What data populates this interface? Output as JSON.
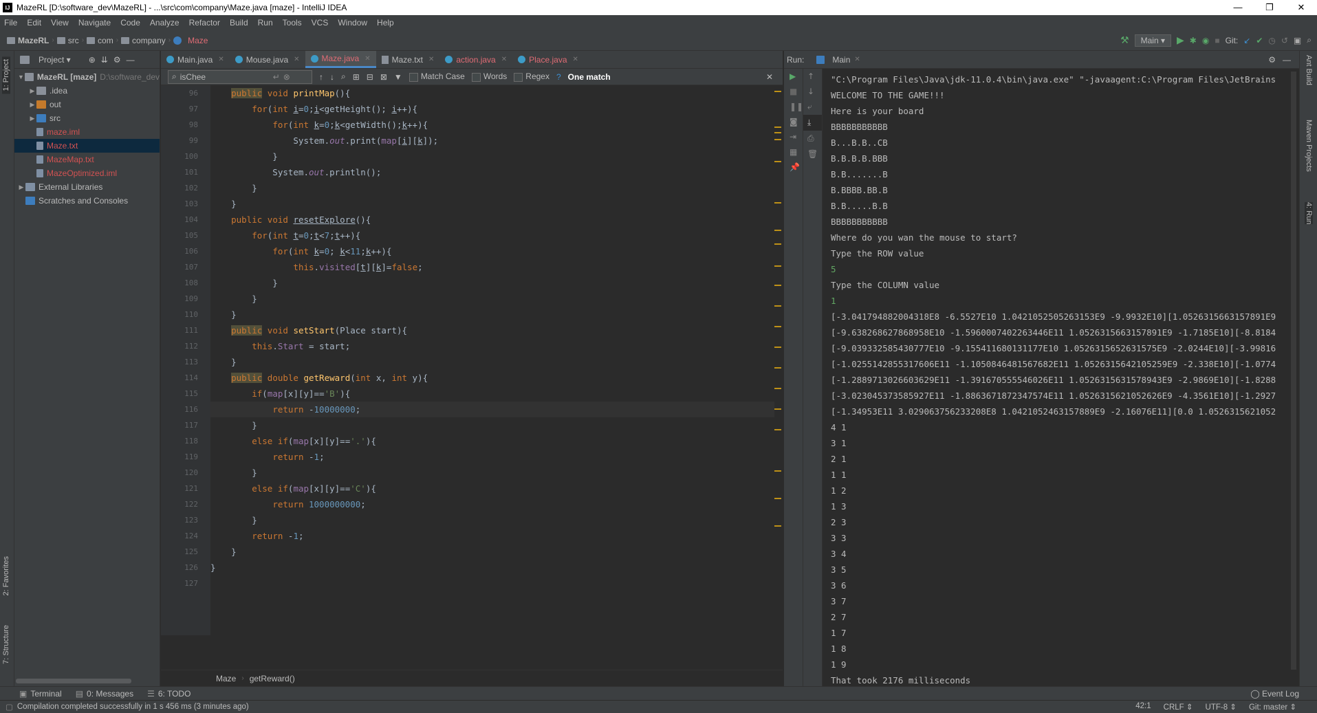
{
  "window": {
    "title": "MazeRL [D:\\software_dev\\MazeRL] - ...\\src\\com\\company\\Maze.java [maze] - IntelliJ IDEA",
    "min": "—",
    "max": "❐",
    "close": "✕"
  },
  "menu": [
    "File",
    "Edit",
    "View",
    "Navigate",
    "Code",
    "Analyze",
    "Refactor",
    "Build",
    "Run",
    "Tools",
    "VCS",
    "Window",
    "Help"
  ],
  "breadcrumb": [
    "MazeRL",
    "src",
    "com",
    "company",
    "Maze"
  ],
  "toolbar": {
    "run_config": "Main ▾",
    "git_label": "Git:"
  },
  "left_tabs": {
    "project": "1: Project",
    "favorites": "2: Favorites",
    "structure": "7: Structure"
  },
  "project_panel": {
    "title": "Project ▾",
    "tree": [
      {
        "label": "MazeRL [maze]",
        "suffix": "D:\\software_dev",
        "indent": 0,
        "arrow": "▼",
        "icon": "proj",
        "cls": ""
      },
      {
        "label": ".idea",
        "indent": 1,
        "arrow": "▶",
        "icon": "folder",
        "cls": ""
      },
      {
        "label": "out",
        "indent": 1,
        "arrow": "▶",
        "icon": "orange",
        "cls": ""
      },
      {
        "label": "src",
        "indent": 1,
        "arrow": "▶",
        "icon": "blue",
        "cls": ""
      },
      {
        "label": "maze.iml",
        "indent": 1,
        "arrow": "",
        "icon": "file",
        "cls": "red"
      },
      {
        "label": "Maze.txt",
        "indent": 1,
        "arrow": "",
        "icon": "file",
        "cls": "red",
        "selected": true
      },
      {
        "label": "MazeMap.txt",
        "indent": 1,
        "arrow": "",
        "icon": "file",
        "cls": "red"
      },
      {
        "label": "MazeOptimized.iml",
        "indent": 1,
        "arrow": "",
        "icon": "file",
        "cls": "red"
      },
      {
        "label": "External Libraries",
        "indent": 0,
        "arrow": "▶",
        "icon": "lib",
        "cls": ""
      },
      {
        "label": "Scratches and Consoles",
        "indent": 0,
        "arrow": "",
        "icon": "blue",
        "cls": ""
      }
    ]
  },
  "editor_tabs": [
    {
      "label": "Main.java",
      "icon": "c",
      "active": false
    },
    {
      "label": "Mouse.java",
      "icon": "c",
      "active": false
    },
    {
      "label": "Maze.java",
      "icon": "c",
      "active": true
    },
    {
      "label": "Maze.txt",
      "icon": "t",
      "active": false
    },
    {
      "label": "action.java",
      "icon": "c",
      "active": false
    },
    {
      "label": "Place.java",
      "icon": "c",
      "active": false
    }
  ],
  "find": {
    "value": "isChee",
    "match_case": "Match Case",
    "words": "Words",
    "regex": "Regex",
    "help": "?",
    "result": "One match"
  },
  "code_lines": [
    {
      "n": "96",
      "html": "    <span class=\"kwh\">public</span> <span class=\"kw\">void</span> <span class=\"fn\">printMap</span>(){"
    },
    {
      "n": "97",
      "html": "        <span class=\"kw\">for</span>(<span class=\"kw\">int</span> <span class=\"ul\">i</span>=<span class=\"num\">0</span>;<span class=\"ul\">i</span>&lt;getHeight(); <span class=\"ul\">i</span>++){"
    },
    {
      "n": "98",
      "html": "            <span class=\"kw\">for</span>(<span class=\"kw\">int</span> <span class=\"ul\">k</span>=<span class=\"num\">0</span>;<span class=\"ul\">k</span>&lt;getWidth();<span class=\"ul\">k</span>++){"
    },
    {
      "n": "99",
      "html": "                System.<span class=\"it\">out</span>.print(<span class=\"fld\">map</span>[<span class=\"ul\">i</span>][<span class=\"ul\">k</span>]);"
    },
    {
      "n": "100",
      "html": "            }"
    },
    {
      "n": "101",
      "html": "            System.<span class=\"it\">out</span>.println();"
    },
    {
      "n": "102",
      "html": "        }"
    },
    {
      "n": "103",
      "html": "    }"
    },
    {
      "n": "104",
      "html": "    <span class=\"kw\">public</span> <span class=\"kw\">void</span> <span class=\"ul\">resetExplore</span>(){"
    },
    {
      "n": "105",
      "html": "        <span class=\"kw\">for</span>(<span class=\"kw\">int</span> <span class=\"ul\">t</span>=<span class=\"num\">0</span>;<span class=\"ul\">t</span>&lt;<span class=\"num\">7</span>;<span class=\"ul\">t</span>++){"
    },
    {
      "n": "106",
      "html": "            <span class=\"kw\">for</span>(<span class=\"kw\">int</span> <span class=\"ul\">k</span>=<span class=\"num\">0</span>; <span class=\"ul\">k</span>&lt;<span class=\"num\">11</span>;<span class=\"ul\">k</span>++){"
    },
    {
      "n": "107",
      "html": "                <span class=\"kw\">this</span>.<span class=\"fld\">visited</span>[<span class=\"ul\">t</span>][<span class=\"ul\">k</span>]=<span class=\"kw\">false</span>;"
    },
    {
      "n": "108",
      "html": "            }"
    },
    {
      "n": "109",
      "html": "        }"
    },
    {
      "n": "110",
      "html": "    }"
    },
    {
      "n": "111",
      "html": "    <span class=\"kwh\">public</span> <span class=\"kw\">void</span> <span class=\"fn\">setStart</span>(Place start){"
    },
    {
      "n": "112",
      "html": "        <span class=\"kw\">this</span>.<span class=\"fld\">Start</span> = start;"
    },
    {
      "n": "113",
      "html": "    }"
    },
    {
      "n": "114",
      "html": "    <span class=\"kwh\">public</span> <span class=\"kw\">double</span> <span class=\"fn\">getReward</span>(<span class=\"kw\">int</span> x, <span class=\"kw\">int</span> y){"
    },
    {
      "n": "115",
      "html": "        <span class=\"kw\">if</span>(<span class=\"fld\">map</span>[x][y]==<span class=\"str\">'B'</span>){"
    },
    {
      "n": "116",
      "html": "            <span class=\"kw\">return</span> -<span class=\"num\">10000000</span>;",
      "cur": true
    },
    {
      "n": "117",
      "html": "        }"
    },
    {
      "n": "118",
      "html": "        <span class=\"kw\">else if</span>(<span class=\"fld\">map</span>[x][y]==<span class=\"str\">'.'</span>){"
    },
    {
      "n": "119",
      "html": "            <span class=\"kw\">return</span> -<span class=\"num\">1</span>;"
    },
    {
      "n": "120",
      "html": "        }"
    },
    {
      "n": "121",
      "html": "        <span class=\"kw\">else if</span>(<span class=\"fld\">map</span>[x][y]==<span class=\"str\">'C'</span>){"
    },
    {
      "n": "122",
      "html": "            <span class=\"kw\">return</span> <span class=\"num\">1000000000</span>;"
    },
    {
      "n": "123",
      "html": "        }"
    },
    {
      "n": "124",
      "html": "        <span class=\"kw\">return</span> -<span class=\"num\">1</span>;"
    },
    {
      "n": "125",
      "html": "    }"
    },
    {
      "n": "126",
      "html": "}"
    },
    {
      "n": "127",
      "html": ""
    }
  ],
  "editor_breadcrumb": [
    "Maze",
    "getReward()"
  ],
  "run_panel": {
    "label": "Run:",
    "tab": "Main",
    "console": [
      {
        "t": "\"C:\\Program Files\\Java\\jdk-11.0.4\\bin\\java.exe\" \"-javaagent:C:\\Program Files\\JetBrains"
      },
      {
        "t": "WELCOME TO THE GAME!!!"
      },
      {
        "t": "Here is your board"
      },
      {
        "t": "BBBBBBBBBBB"
      },
      {
        "t": "B...B.B..CB"
      },
      {
        "t": "B.B.B.B.BBB"
      },
      {
        "t": "B.B.......B"
      },
      {
        "t": "B.BBBB.BB.B"
      },
      {
        "t": "B.B.....B.B"
      },
      {
        "t": "BBBBBBBBBBB"
      },
      {
        "t": "Where do you wan the mouse to start?"
      },
      {
        "t": "Type the ROW value"
      },
      {
        "t": "5",
        "input": true
      },
      {
        "t": "Type the COLUMN value"
      },
      {
        "t": "1",
        "input": true
      },
      {
        "t": "[-3.0417948820043​18E8 -6.5527E10 1.0421052505263153E9 -9.9932E10][1.05263156631578​91E9"
      },
      {
        "t": "[-9.638268627868958E10 -1.5960007402263446E11 1.052631566315789​1E9 -1.7185E10][-8.8184"
      },
      {
        "t": "[-9.039332585430777E10 -9.155411680131177E10 1.052631565263157​5E9 -2.0244E10][-3.99816"
      },
      {
        "t": "[-1.0255142855317606E11 -1.1050846481567682E11 1.0526315642105259E9 -2.338E10][-1.0774"
      },
      {
        "t": "[-1.2889713026603629E11 -1.391670555546026E11 1.0526315631578943E9 -2.9869E10][-1.8288"
      },
      {
        "t": "[-3.023045373585927E11 -1.8863671872347574E11 1.0526315621052626E9 -4.3561E10][-1.2927"
      },
      {
        "t": "[-1.34953E11 3.029063756233208E8 1.0421052463157889E9 -2.16076E11][0.0 1.0526315621052"
      },
      {
        "t": "4 1"
      },
      {
        "t": "3 1"
      },
      {
        "t": "2 1"
      },
      {
        "t": "1 1"
      },
      {
        "t": "1 2"
      },
      {
        "t": "1 3"
      },
      {
        "t": "2 3"
      },
      {
        "t": "3 3"
      },
      {
        "t": "3 4"
      },
      {
        "t": "3 5"
      },
      {
        "t": "3 6"
      },
      {
        "t": "3 7"
      },
      {
        "t": "2 7"
      },
      {
        "t": "1 7"
      },
      {
        "t": "1 8"
      },
      {
        "t": "1 9"
      },
      {
        "t": "That took 2176 milliseconds"
      }
    ]
  },
  "right_tabs": {
    "ant": "Ant Build",
    "maven": "Maven Projects",
    "run": "4: Run"
  },
  "bottom_tabs": [
    "Terminal",
    "0: Messages",
    "6: TODO"
  ],
  "event_log": "Event Log",
  "status": {
    "message": "Compilation completed successfully in 1 s 456 ms (3 minutes ago)",
    "position": "42:1",
    "line_sep": "CRLF ⇕",
    "encoding": "UTF-8 ⇕",
    "git": "Git: master ⇕"
  }
}
